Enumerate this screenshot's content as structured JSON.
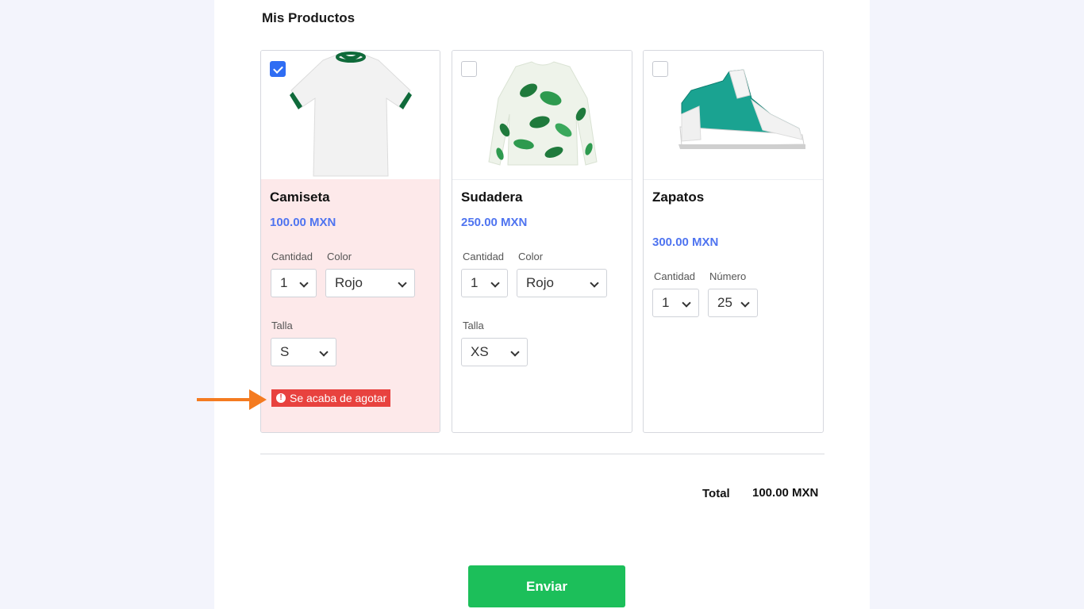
{
  "section_title": "Mis Productos",
  "products": [
    {
      "name": "Camiseta",
      "price": "100.00 MXN",
      "checked": true,
      "quantity_label": "Cantidad",
      "quantity_value": "1",
      "color_label": "Color",
      "color_value": "Rojo",
      "size_label": "Talla",
      "size_value": "S",
      "alert": "Se acaba de agotar",
      "image_icon": "tshirt-icon"
    },
    {
      "name": "Sudadera",
      "price": "250.00 MXN",
      "checked": false,
      "quantity_label": "Cantidad",
      "quantity_value": "1",
      "color_label": "Color",
      "color_value": "Rojo",
      "size_label": "Talla",
      "size_value": "XS",
      "image_icon": "sweatshirt-icon"
    },
    {
      "name": "Zapatos",
      "price": "300.00 MXN",
      "checked": false,
      "quantity_label": "Cantidad",
      "quantity_value": "1",
      "number_label": "Número",
      "number_value": "25",
      "image_icon": "sneaker-icon"
    }
  ],
  "total": {
    "label": "Total",
    "value": "100.00 MXN"
  },
  "submit_label": "Enviar",
  "colors": {
    "accent_blue": "#2f6df3",
    "price_blue": "#4f74f0",
    "selected_bg": "#fde9ea",
    "alert_red": "#e8423f",
    "submit_green": "#1cbf5a",
    "arrow_orange": "#f47b20"
  }
}
